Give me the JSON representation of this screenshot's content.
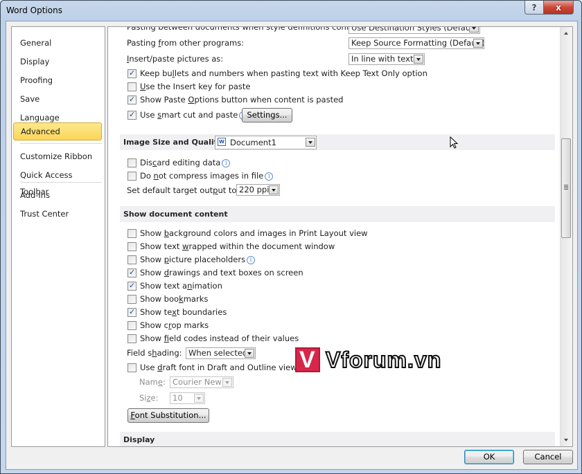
{
  "window": {
    "title": "Word Options",
    "help_label": "?",
    "close_label": "x"
  },
  "sidebar": {
    "items": [
      {
        "label": "General"
      },
      {
        "label": "Display"
      },
      {
        "label": "Proofing"
      },
      {
        "label": "Save"
      },
      {
        "label": "Language"
      },
      {
        "label": "Advanced",
        "active": true
      },
      {
        "label": "Customize Ribbon"
      },
      {
        "label": "Quick Access Toolbar"
      },
      {
        "label": "Add-Ins"
      },
      {
        "label": "Trust Center"
      }
    ]
  },
  "paste": {
    "between_docs_label": "Pasting between documents when style definitions conflict:",
    "between_docs_value": "Use Destination Styles (Default)",
    "other_programs_label": "Pasting from other programs:",
    "other_programs_value": "Keep Source Formatting (Default)",
    "pictures_label": "Insert/paste pictures as:",
    "pictures_value": "In line with text",
    "options": [
      {
        "label": "Keep bullets and numbers when pasting text with Keep Text Only option",
        "checked": true
      },
      {
        "label": "Use the Insert key for paste",
        "checked": false
      },
      {
        "label": "Show Paste Options button when content is pasted",
        "checked": true
      },
      {
        "label": "Use smart cut and paste",
        "checked": true
      }
    ],
    "settings_button": "Settings..."
  },
  "image_size": {
    "section_title": "Image Size and Quality",
    "document_value": "Document1",
    "options": [
      {
        "label": "Discard editing data",
        "checked": false
      },
      {
        "label": "Do not compress images in file",
        "checked": false
      }
    ],
    "target_output_label": "Set default target output to:",
    "target_output_value": "220 ppi"
  },
  "show_content": {
    "section_title": "Show document content",
    "options": [
      {
        "label": "Show background colors and images in Print Layout view",
        "checked": false
      },
      {
        "label": "Show text wrapped within the document window",
        "checked": false
      },
      {
        "label": "Show picture placeholders",
        "checked": false
      },
      {
        "label": "Show drawings and text boxes on screen",
        "checked": true
      },
      {
        "label": "Show text animation",
        "checked": true
      },
      {
        "label": "Show bookmarks",
        "checked": false
      },
      {
        "label": "Show text boundaries",
        "checked": true
      },
      {
        "label": "Show crop marks",
        "checked": false
      },
      {
        "label": "Show field codes instead of their values",
        "checked": false
      }
    ],
    "field_shading_label": "Field shading:",
    "field_shading_value": "When selected",
    "draft_font_label": "Use draft font in Draft and Outline views",
    "draft_font_checked": false,
    "name_label": "Name:",
    "name_value": "Courier New",
    "size_label": "Size:",
    "size_value": "10",
    "font_substitution_button": "Font Substitution..."
  },
  "display": {
    "section_title": "Display"
  },
  "footer": {
    "ok_label": "OK",
    "cancel_label": "Cancel"
  },
  "watermark": {
    "text": "Vforum.vn"
  },
  "scroll": {
    "position_fraction": 0.3
  },
  "colors": {
    "active_nav": "#fbd55a",
    "section_bg": "#f0f0f2",
    "close_button": "#c9483a",
    "check_mark": "#2a4b8d"
  }
}
